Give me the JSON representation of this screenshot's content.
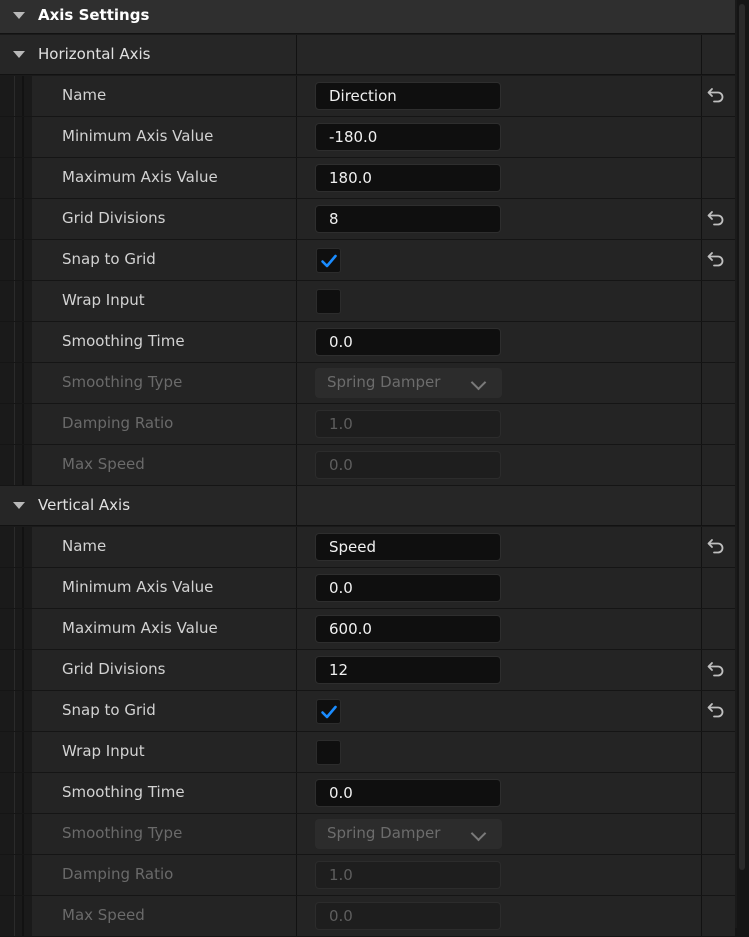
{
  "category": {
    "title": "Axis Settings"
  },
  "horizontal": {
    "title": "Horizontal Axis",
    "props": [
      {
        "name": "Name",
        "type": "text",
        "value": "Direction",
        "reset": true,
        "enabled": true
      },
      {
        "name": "Minimum Axis Value",
        "type": "text",
        "value": "-180.0",
        "reset": false,
        "enabled": true
      },
      {
        "name": "Maximum Axis Value",
        "type": "text",
        "value": "180.0",
        "reset": false,
        "enabled": true
      },
      {
        "name": "Grid Divisions",
        "type": "text",
        "value": "8",
        "reset": true,
        "enabled": true
      },
      {
        "name": "Snap to Grid",
        "type": "check",
        "value": true,
        "reset": true,
        "enabled": true
      },
      {
        "name": "Wrap Input",
        "type": "check",
        "value": false,
        "reset": false,
        "enabled": true
      },
      {
        "name": "Smoothing Time",
        "type": "text",
        "value": "0.0",
        "reset": false,
        "enabled": true
      },
      {
        "name": "Smoothing Type",
        "type": "combo",
        "value": "Spring Damper",
        "reset": false,
        "enabled": false
      },
      {
        "name": "Damping Ratio",
        "type": "text",
        "value": "1.0",
        "reset": false,
        "enabled": false
      },
      {
        "name": "Max Speed",
        "type": "text",
        "value": "0.0",
        "reset": false,
        "enabled": false
      }
    ]
  },
  "vertical": {
    "title": "Vertical Axis",
    "props": [
      {
        "name": "Name",
        "type": "text",
        "value": "Speed",
        "reset": true,
        "enabled": true
      },
      {
        "name": "Minimum Axis Value",
        "type": "text",
        "value": "0.0",
        "reset": false,
        "enabled": true
      },
      {
        "name": "Maximum Axis Value",
        "type": "text",
        "value": "600.0",
        "reset": false,
        "enabled": true
      },
      {
        "name": "Grid Divisions",
        "type": "text",
        "value": "12",
        "reset": true,
        "enabled": true
      },
      {
        "name": "Snap to Grid",
        "type": "check",
        "value": true,
        "reset": true,
        "enabled": true
      },
      {
        "name": "Wrap Input",
        "type": "check",
        "value": false,
        "reset": false,
        "enabled": true
      },
      {
        "name": "Smoothing Time",
        "type": "text",
        "value": "0.0",
        "reset": false,
        "enabled": true
      },
      {
        "name": "Smoothing Type",
        "type": "combo",
        "value": "Spring Damper",
        "reset": false,
        "enabled": false
      },
      {
        "name": "Damping Ratio",
        "type": "text",
        "value": "1.0",
        "reset": false,
        "enabled": false
      },
      {
        "name": "Max Speed",
        "type": "text",
        "value": "0.0",
        "reset": false,
        "enabled": false
      }
    ]
  },
  "icons": {
    "expand": "caret-down-icon",
    "reset": "reset-to-default-icon",
    "check": "checkmark-icon",
    "dropdown": "chevron-down-icon"
  },
  "colors": {
    "accent": "#1a8cff",
    "panel": "#242424",
    "field": "#0f0f0f"
  }
}
